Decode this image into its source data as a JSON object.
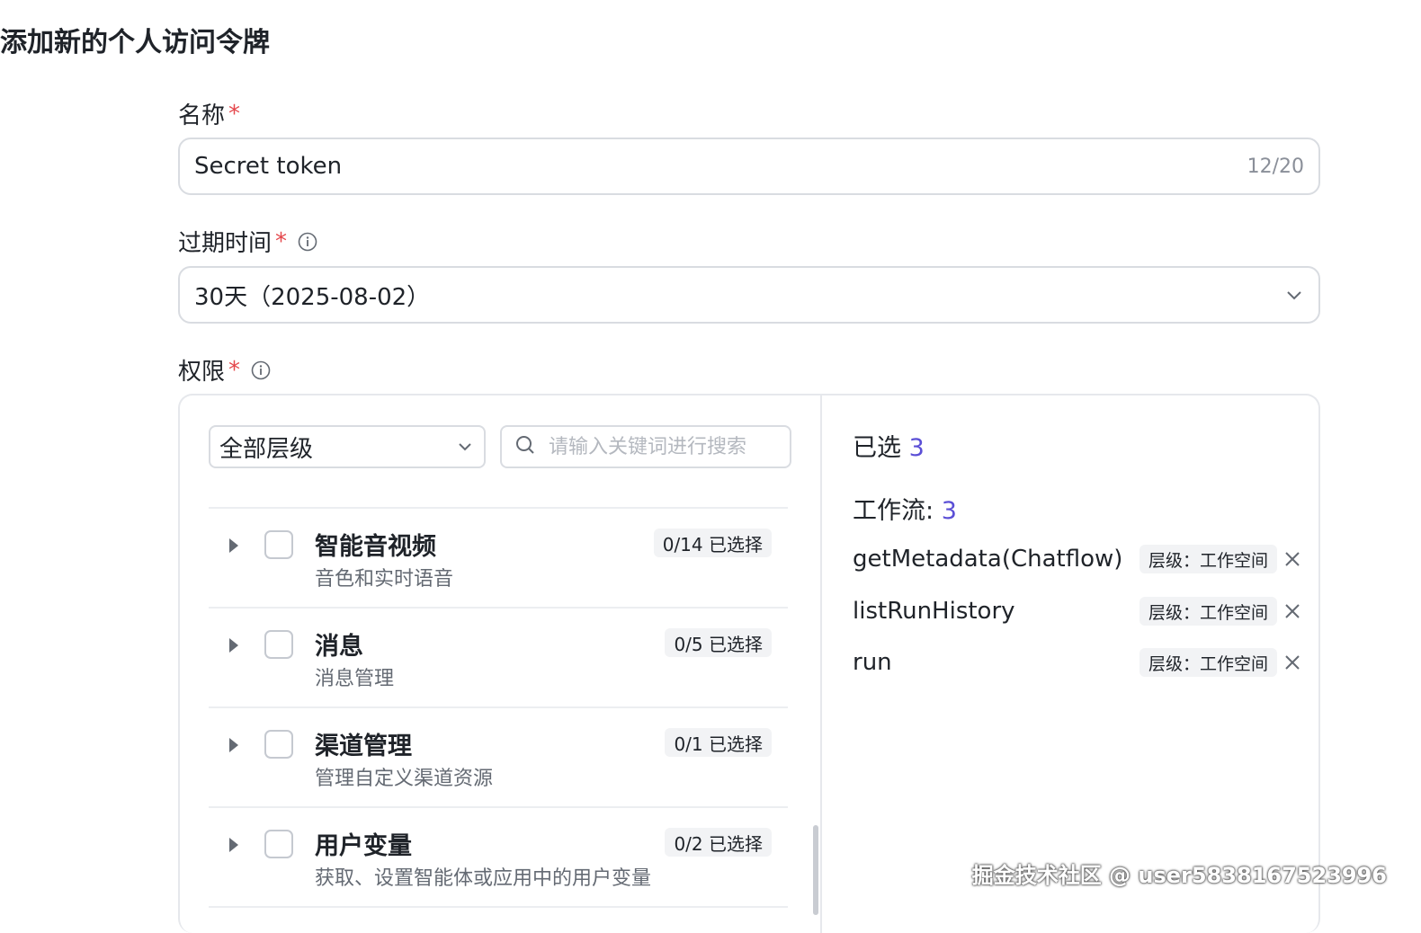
{
  "page": {
    "title": "添加新的个人访问令牌"
  },
  "name_field": {
    "label": "名称",
    "required_mark": "*",
    "value": "Secret token",
    "count": "12/20"
  },
  "expiry_field": {
    "label": "过期时间",
    "required_mark": "*",
    "value": "30天（2025-08-02）"
  },
  "permissions": {
    "label": "权限",
    "required_mark": "*",
    "level_select": "全部层级",
    "search_placeholder": "请输入关键词进行搜索",
    "items": [
      {
        "title": "智能音视频",
        "desc": "音色和实时语音",
        "badge": "0/14 已选择"
      },
      {
        "title": "消息",
        "desc": "消息管理",
        "badge": "0/5 已选择"
      },
      {
        "title": "渠道管理",
        "desc": "管理自定义渠道资源",
        "badge": "0/1 已选择"
      },
      {
        "title": "用户变量",
        "desc": "获取、设置智能体或应用中的用户变量",
        "badge": "0/2 已选择"
      }
    ],
    "selected": {
      "label": "已选",
      "count": "3",
      "group_label": "工作流:",
      "group_count": "3",
      "items": [
        {
          "name": "getMetadata(Chatflow)",
          "tag": "层级：工作空间"
        },
        {
          "name": "listRunHistory",
          "tag": "层级：工作空间"
        },
        {
          "name": "run",
          "tag": "层级：工作空间"
        }
      ]
    }
  },
  "watermark": "掘金技术社区 @ user5838167523996",
  "colors": {
    "accent": "#5b4fd6",
    "required": "#e5484d",
    "border": "#d9dce1"
  }
}
